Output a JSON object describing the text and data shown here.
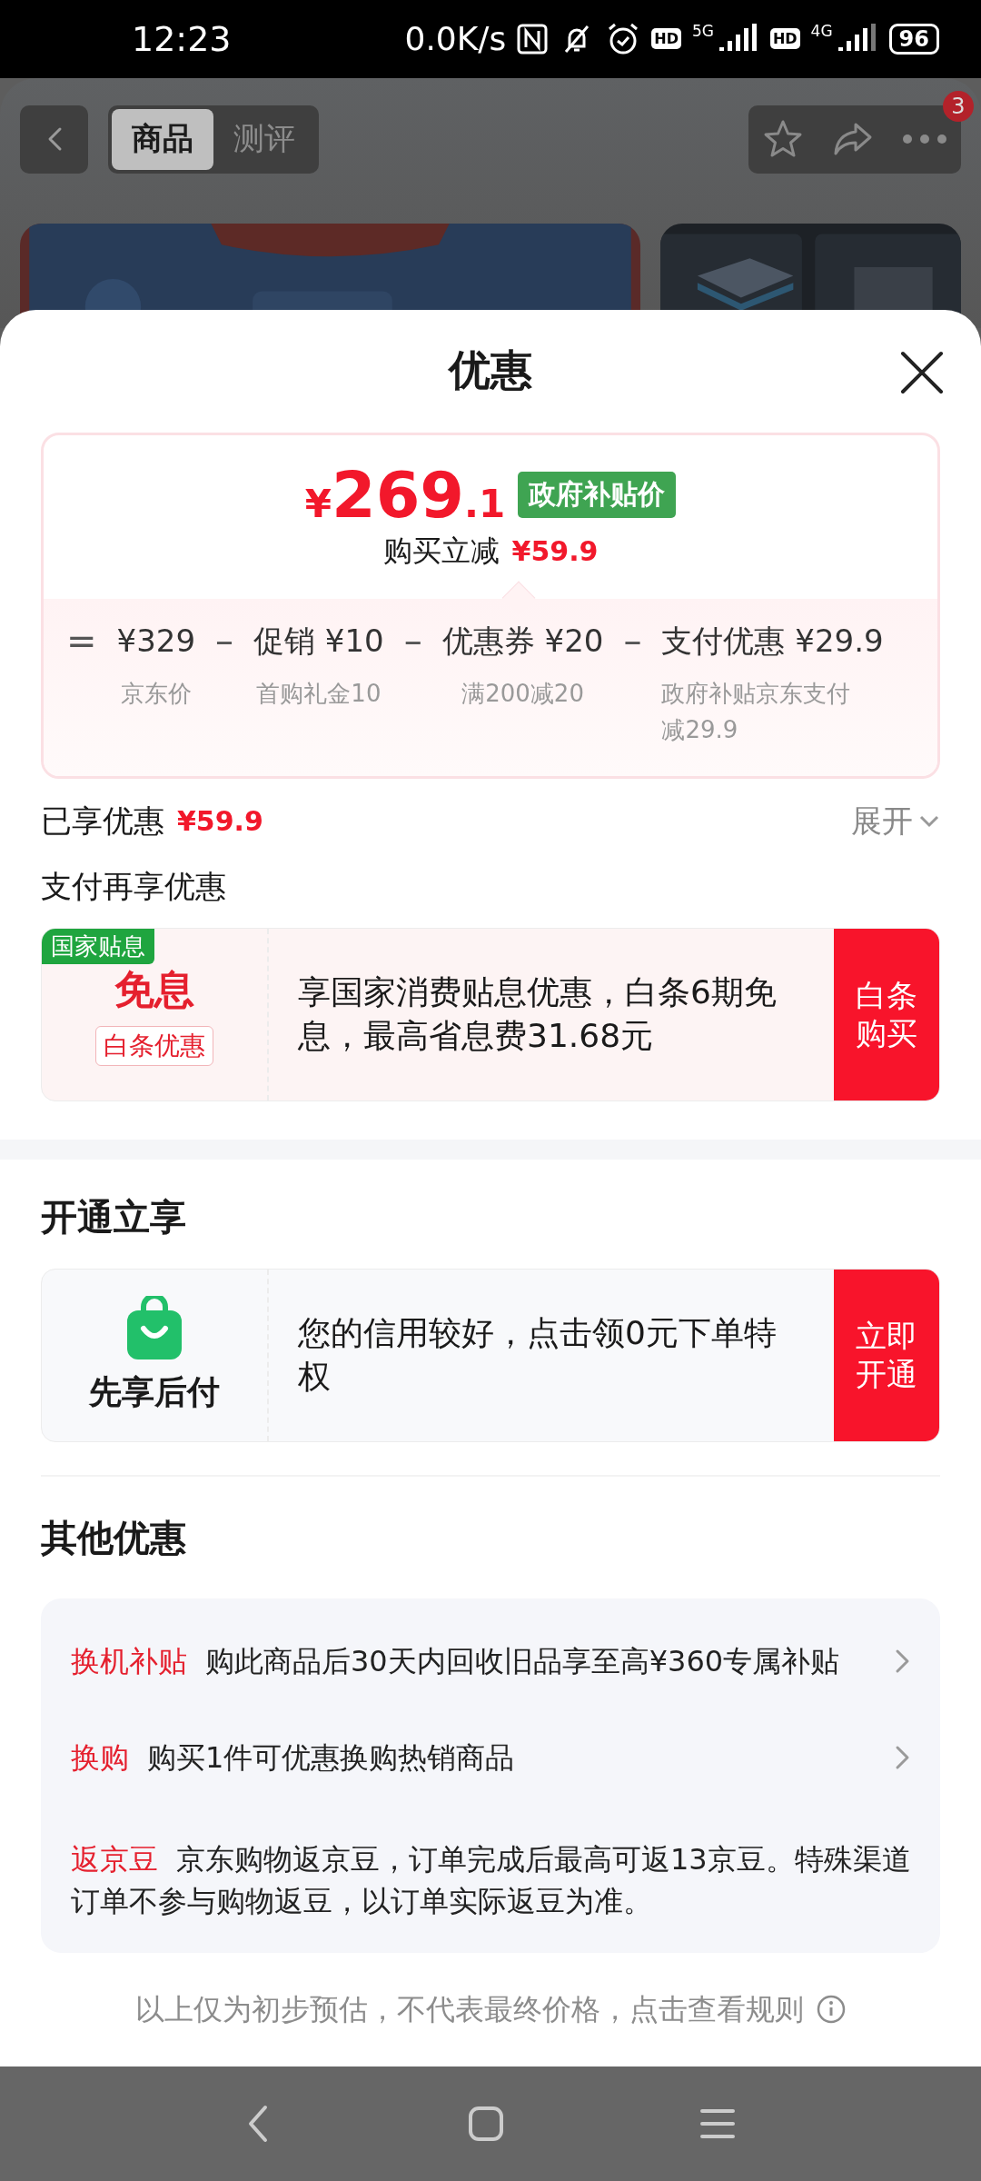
{
  "status_bar": {
    "time": "12:23",
    "speed": "0.0K/s",
    "sims": [
      {
        "hd": "HD",
        "network": "5G"
      },
      {
        "hd": "HD",
        "network": "4G"
      }
    ],
    "battery": "96"
  },
  "header": {
    "tabs": [
      {
        "label": "商品",
        "selected": true
      },
      {
        "label": "测评",
        "selected": false
      }
    ],
    "badge": "3"
  },
  "sheet": {
    "title": "优惠"
  },
  "price_card": {
    "currency": "¥",
    "price_main": "269",
    "price_decimal": ".1",
    "tag": "政府补贴价",
    "reduction_label": "购买立减",
    "reduction_value": "¥59.9",
    "breakdown": [
      {
        "operator": "=",
        "amount": "¥329",
        "note": "京东价"
      },
      {
        "operator": "–",
        "amount": "促销 ¥10",
        "note": "首购礼金10"
      },
      {
        "operator": "–",
        "amount": "优惠券 ¥20",
        "note": "满200减20"
      },
      {
        "operator": "–",
        "amount": "支付优惠 ¥29.9",
        "note": "政府补贴京东支付减29.9"
      }
    ]
  },
  "enjoyed": {
    "label": "已享优惠",
    "value": "¥59.9",
    "expand": "展开"
  },
  "pay_section": {
    "title": "支付再享优惠",
    "offer": {
      "ribbon": "国家贴息",
      "headline": "免息",
      "sub_tag": "白条优惠",
      "description": "享国家消费贴息优惠，白条6期免息，最高省息费31.68元",
      "action": "白条购买"
    }
  },
  "open_section": {
    "title": "开通立享",
    "offer": {
      "label": "先享后付",
      "description": "您的信用较好，点击领0元下单特权",
      "action": "立即开通"
    }
  },
  "other_section": {
    "title": "其他优惠",
    "items": [
      {
        "kind": "link",
        "tag": "换机补贴",
        "text": "购此商品后30天内回收旧品享至高¥360专属补贴"
      },
      {
        "kind": "link",
        "tag": "换购",
        "text": "购买1件可优惠换购热销商品"
      },
      {
        "kind": "info",
        "tag": "返京豆",
        "text": "京东购物返京豆，订单完成后最高可返13京豆。特殊渠道订单不参与购物返豆，以订单实际返豆为准。"
      }
    ]
  },
  "footer": {
    "text": "以上仅为初步预估，不代表最终价格，点击查看规则"
  }
}
